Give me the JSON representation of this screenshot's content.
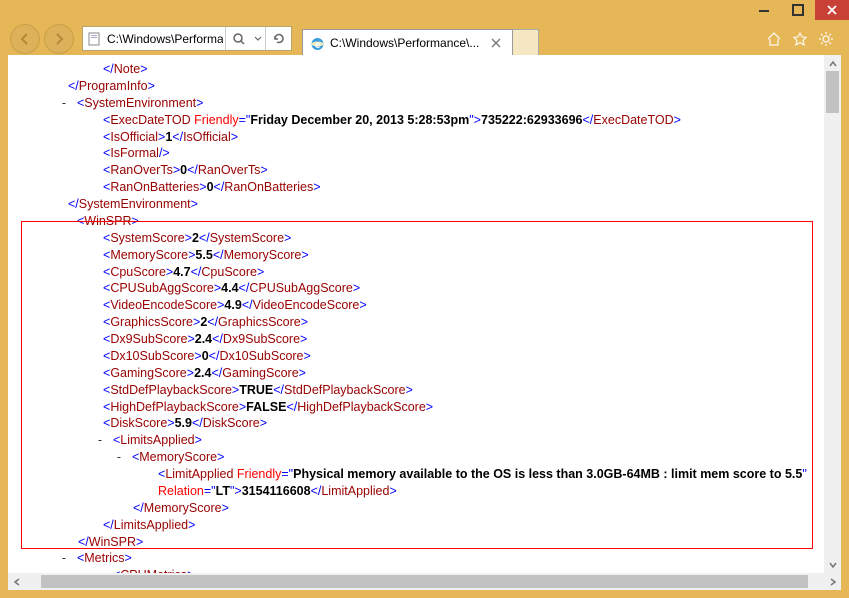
{
  "address": {
    "text": "C:\\Windows\\Performan",
    "placeholder": ""
  },
  "tab": {
    "title": "C:\\Windows\\Performance\\..."
  },
  "xml": {
    "note_close": "Note",
    "programinfo_close": "ProgramInfo",
    "sysenv": "SystemEnvironment",
    "execdatetod": "ExecDateTOD",
    "friendly_attr": "Friendly",
    "friendly_val": "Friday December 20, 2013 5:28:53pm",
    "execdatetod_val": "735222:62933696",
    "isofficial": "IsOfficial",
    "isofficial_val": "1",
    "isformal": "IsFormal",
    "ranoverts": "RanOverTs",
    "ranoverts_val": "0",
    "ranonbatteries": "RanOnBatteries",
    "ranonbatteries_val": "0",
    "winspr": "WinSPR",
    "systemscore": "SystemScore",
    "systemscore_val": "2",
    "memoryscore": "MemoryScore",
    "memoryscore_val": "5.5",
    "cpuscore": "CpuScore",
    "cpuscore_val": "4.7",
    "cpusubaggscore": "CPUSubAggScore",
    "cpusubaggscore_val": "4.4",
    "videoencodescore": "VideoEncodeScore",
    "videoencodescore_val": "4.9",
    "graphicsscore": "GraphicsScore",
    "graphicsscore_val": "2",
    "dx9subscore": "Dx9SubScore",
    "dx9subscore_val": "2.4",
    "dx10subscore": "Dx10SubScore",
    "dx10subscore_val": "0",
    "gamingscore": "GamingScore",
    "gamingscore_val": "2.4",
    "stddefplaybackscore": "StdDefPlaybackScore",
    "stddefplaybackscore_val": "TRUE",
    "highdefplaybackscore": "HighDefPlaybackScore",
    "highdefplaybackscore_val": "FALSE",
    "diskscore": "DiskScore",
    "diskscore_val": "5.9",
    "limitsapplied": "LimitsApplied",
    "limitapplied": "LimitApplied",
    "limit_friendly_val": "Physical memory available to the OS is less than 3.0GB-64MB : limit mem score to 5.5",
    "relation_attr": "Relation",
    "relation_val": "LT",
    "limitapplied_val": "3154116608",
    "metrics": "Metrics",
    "cpumetrics": "CPUMetrics"
  }
}
